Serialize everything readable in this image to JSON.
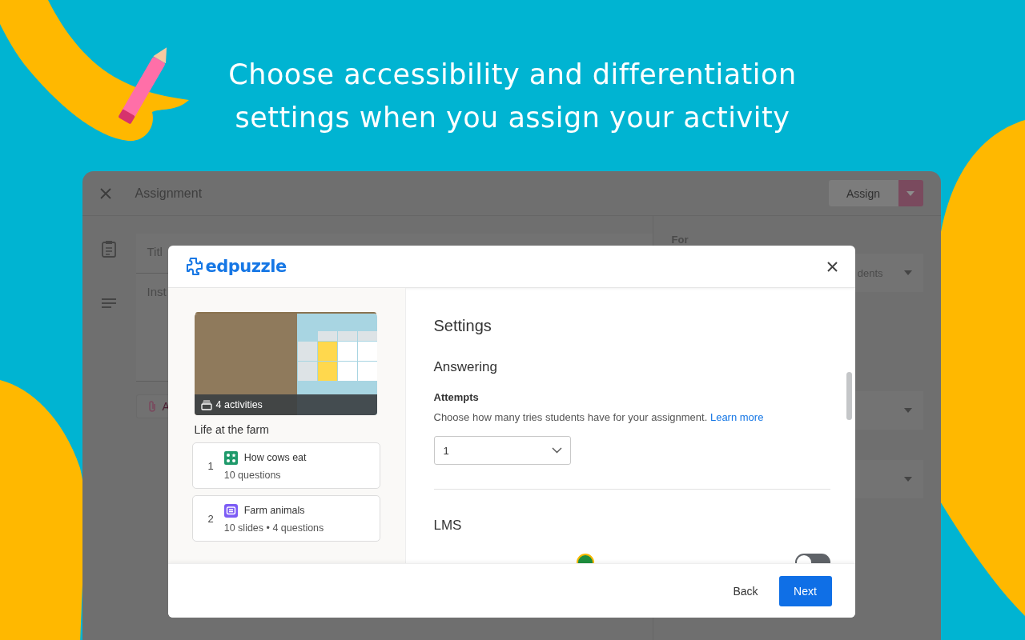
{
  "banner": {
    "headline_lines": [
      "Choose accessibility and differentiation",
      "settings when you assign your activity"
    ]
  },
  "background_window": {
    "title": "Assignment",
    "assign_button": "Assign",
    "title_field": "Titl",
    "instructions_field": "Inst",
    "attach_button": "A",
    "for_label": "For",
    "for_select": "dents"
  },
  "dialog": {
    "logo": "edpuzzle",
    "collection": {
      "badge": "4 activities",
      "title": "Life at the farm"
    },
    "activities": [
      {
        "number": "1",
        "kind": "quiz",
        "title": "How cows eat",
        "meta": "10 questions"
      },
      {
        "number": "2",
        "kind": "slides",
        "title": "Farm animals",
        "meta": "10 slides • 4 questions"
      }
    ],
    "settings": {
      "heading": "Settings",
      "answering": {
        "heading": "Answering",
        "attempts": {
          "label": "Attempts",
          "description": "Choose how many tries students have for your assignment.",
          "link": "Learn more",
          "value": "1"
        }
      },
      "lms": {
        "heading": "LMS",
        "toggle_on": false
      }
    },
    "footer": {
      "back": "Back",
      "next": "Next"
    }
  }
}
